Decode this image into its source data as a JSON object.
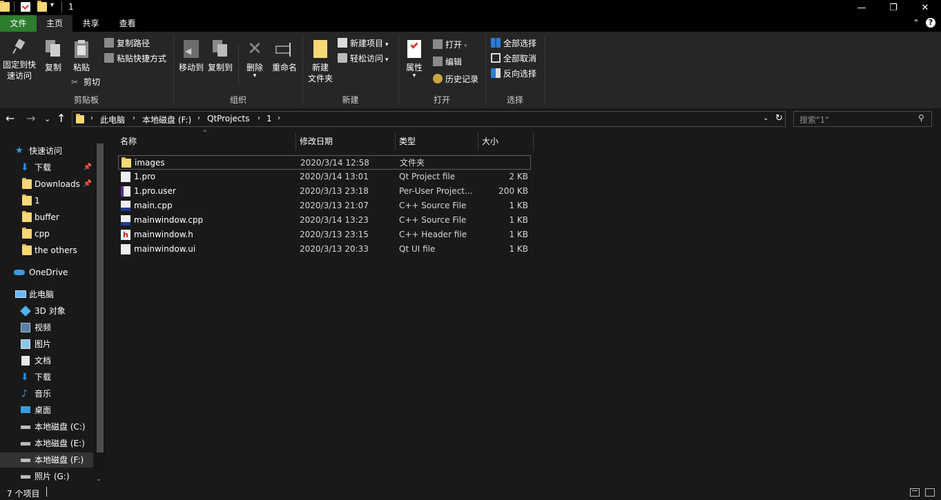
{
  "window": {
    "title": "1",
    "minimize": "—",
    "restore": "❐",
    "close": "✕"
  },
  "ribbon_tabs": {
    "file": "文件",
    "home": "主页",
    "share": "共享",
    "view": "查看"
  },
  "ribbon": {
    "clipboard": {
      "label": "剪贴板",
      "pin_l1": "固定到快",
      "pin_l2": "速访问",
      "copy": "复制",
      "paste": "粘贴",
      "copy_path": "复制路径",
      "paste_shortcut": "粘贴快捷方式",
      "cut": "剪切"
    },
    "organize": {
      "label": "组织",
      "move_to": "移动到",
      "copy_to": "复制到",
      "delete": "删除",
      "rename": "重命名"
    },
    "new": {
      "label": "新建",
      "new_folder_l1": "新建",
      "new_folder_l2": "文件夹",
      "new_item": "新建项目",
      "easy_access": "轻松访问"
    },
    "open": {
      "label": "打开",
      "properties": "属性",
      "open": "打开",
      "edit": "编辑",
      "history": "历史记录"
    },
    "select": {
      "label": "选择",
      "select_all": "全部选择",
      "select_none": "全部取消",
      "invert": "反向选择"
    }
  },
  "address": {
    "crumbs": [
      "此电脑",
      "本地磁盘 (F:)",
      "QtProjects",
      "1"
    ],
    "search_placeholder": "搜索\"1\""
  },
  "nav": {
    "quick_access": "快速访问",
    "items": [
      {
        "label": "下载"
      },
      {
        "label": "Downloads"
      },
      {
        "label": "1"
      },
      {
        "label": "buffer"
      },
      {
        "label": "cpp"
      },
      {
        "label": "the others"
      }
    ],
    "onedrive": "OneDrive",
    "this_pc": "此电脑",
    "pc_items": [
      {
        "label": "3D 对象"
      },
      {
        "label": "视频"
      },
      {
        "label": "图片"
      },
      {
        "label": "文档"
      },
      {
        "label": "下载"
      },
      {
        "label": "音乐"
      },
      {
        "label": "桌面"
      },
      {
        "label": "本地磁盘 (C:)"
      },
      {
        "label": "本地磁盘 (E:)"
      },
      {
        "label": "本地磁盘 (F:)"
      },
      {
        "label": "照片 (G:)"
      }
    ]
  },
  "columns": {
    "name": "名称",
    "date": "修改日期",
    "type": "类型",
    "size": "大小"
  },
  "files": [
    {
      "name": "images",
      "date": "2020/3/14 12:58",
      "type": "文件夹",
      "size": ""
    },
    {
      "name": "1.pro",
      "date": "2020/3/14 13:01",
      "type": "Qt Project file",
      "size": "2 KB"
    },
    {
      "name": "1.pro.user",
      "date": "2020/3/13 23:18",
      "type": "Per-User Project...",
      "size": "200 KB"
    },
    {
      "name": "main.cpp",
      "date": "2020/3/13 21:07",
      "type": "C++ Source File",
      "size": "1 KB"
    },
    {
      "name": "mainwindow.cpp",
      "date": "2020/3/14 13:23",
      "type": "C++ Source File",
      "size": "1 KB"
    },
    {
      "name": "mainwindow.h",
      "date": "2020/3/13 23:15",
      "type": "C++ Header file",
      "size": "1 KB"
    },
    {
      "name": "mainwindow.ui",
      "date": "2020/3/13 20:33",
      "type": "Qt UI file",
      "size": "1 KB"
    }
  ],
  "status": {
    "count": "7 个项目"
  }
}
